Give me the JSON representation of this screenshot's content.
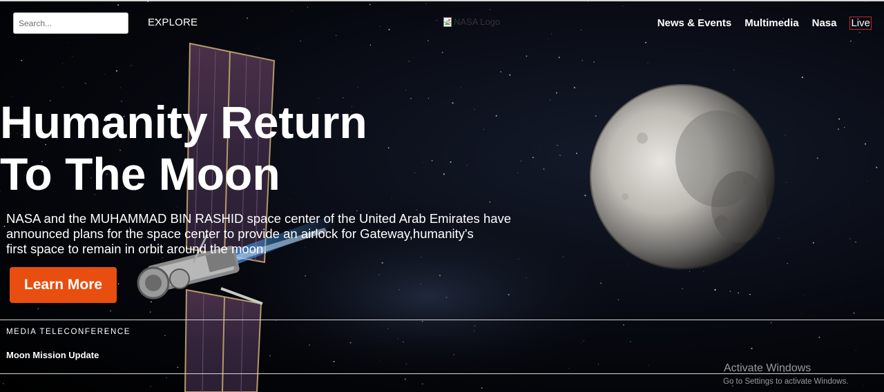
{
  "header": {
    "search_placeholder": "Search...",
    "explore_label": "EXPLORE",
    "logo_alt": "NASA Logo",
    "nav": [
      {
        "label": "News & Events"
      },
      {
        "label": "Multimedia"
      },
      {
        "label": "Nasa"
      },
      {
        "label": "Live"
      }
    ]
  },
  "hero": {
    "title_line1": "Humanity Return",
    "title_line2": "To The Moon",
    "description_line1": "NASA and the MUHAMMAD BIN RASHID space center of the United Arab Emirates have",
    "description_line2": "announced plans for the space center to provide an airlock for Gateway,humanity's",
    "description_line3": "first space to remain in orbit around the moon.",
    "cta_label": "Learn More"
  },
  "media": {
    "label": "MEDIA TELECONFERENCE",
    "link": "Moon Mission Update"
  },
  "watermark": {
    "title": "Activate Windows",
    "subtitle": "Go to Settings to activate Windows."
  },
  "colors": {
    "accent": "#e84e0f",
    "live_border": "#c62a2a",
    "background": "#000000"
  },
  "icons": {
    "logo": "broken-image-icon"
  }
}
